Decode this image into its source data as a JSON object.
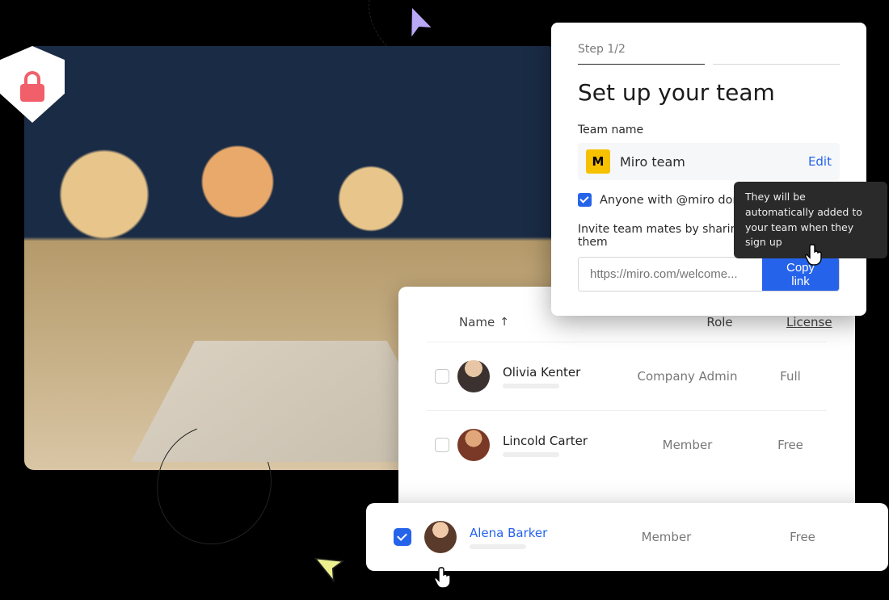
{
  "shield": {
    "icon": "lock"
  },
  "setup": {
    "step_label": "Step 1/2",
    "title": "Set up your team",
    "team_name_label": "Team name",
    "team_badge": "M",
    "team_name": "Miro team",
    "edit_label": "Edit",
    "domain_checkbox_label": "Anyone with @miro domain",
    "invite_label": "Invite team mates by sharing this link with them",
    "link_placeholder": "https://miro.com/welcome...",
    "copy_label": "Copy link"
  },
  "tooltip": {
    "text": "They will be automatically added to your team when they sign up"
  },
  "list": {
    "columns": {
      "name": "Name",
      "role": "Role",
      "license": "License"
    },
    "rows": [
      {
        "name": "Olivia Kenter",
        "role": "Company Admin",
        "license": "Full",
        "checked": false
      },
      {
        "name": "Lincold Carter",
        "role": "Member",
        "license": "Free",
        "checked": false
      }
    ],
    "highlight": {
      "name": "Alena Barker",
      "role": "Member",
      "license": "Free",
      "checked": true
    }
  }
}
